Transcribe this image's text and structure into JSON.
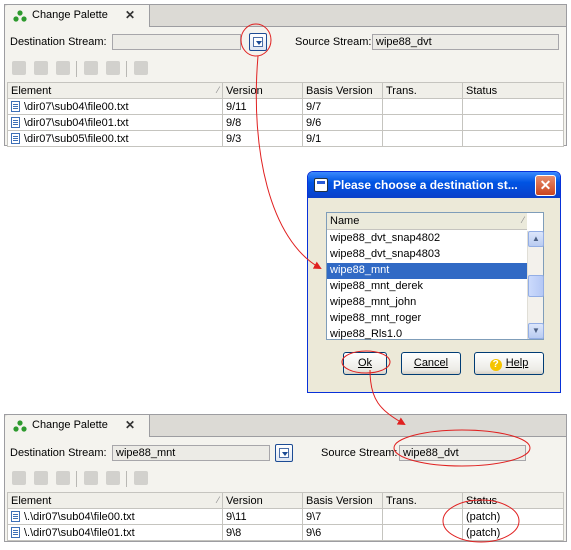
{
  "top_view": {
    "tab_label": "Change Palette",
    "destination_label": "Destination Stream:",
    "destination_value": "",
    "source_label": "Source Stream:",
    "source_value": "wipe88_dvt",
    "columns": [
      "Element",
      "Version",
      "Basis Version",
      "Trans.",
      "Status"
    ],
    "rows": [
      {
        "element": "\\dir07\\sub04\\file00.txt",
        "version": "9/11",
        "basis": "9/7",
        "trans": "",
        "status": ""
      },
      {
        "element": "\\dir07\\sub04\\file01.txt",
        "version": "9/8",
        "basis": "9/6",
        "trans": "",
        "status": ""
      },
      {
        "element": "\\dir07\\sub05\\file00.txt",
        "version": "9/3",
        "basis": "9/1",
        "trans": "",
        "status": ""
      }
    ]
  },
  "dialog": {
    "title": "Please choose a destination st...",
    "column_header": "Name",
    "items": [
      "wipe88_dvt_snap4802",
      "wipe88_dvt_snap4803",
      "wipe88_mnt",
      "wipe88_mnt_derek",
      "wipe88_mnt_john",
      "wipe88_mnt_roger",
      "wipe88_Rls1.0"
    ],
    "selected_item": "wipe88_mnt",
    "ok_label": "Ok",
    "cancel_label": "Cancel",
    "help_label": "Help"
  },
  "bottom_view": {
    "tab_label": "Change Palette",
    "destination_label": "Destination Stream:",
    "destination_value": "wipe88_mnt",
    "source_label": "Source Stream:",
    "source_value": "wipe88_dvt",
    "columns": [
      "Element",
      "Version",
      "Basis Version",
      "Trans.",
      "Status"
    ],
    "rows": [
      {
        "element": "\\.\\dir07\\sub04\\file00.txt",
        "version": "9\\11",
        "basis": "9\\7",
        "trans": "",
        "status": "(patch)"
      },
      {
        "element": "\\.\\dir07\\sub04\\file01.txt",
        "version": "9\\8",
        "basis": "9\\6",
        "trans": "",
        "status": "(patch)"
      }
    ]
  },
  "colors": {
    "annotation": "#e02020",
    "selection": "#316ac5",
    "titlebar": "#0054e3"
  },
  "icons": [
    "palette-icon",
    "close-icon",
    "browse-icon",
    "file-icon",
    "help-icon",
    "scroll-up-icon",
    "scroll-down-icon"
  ]
}
